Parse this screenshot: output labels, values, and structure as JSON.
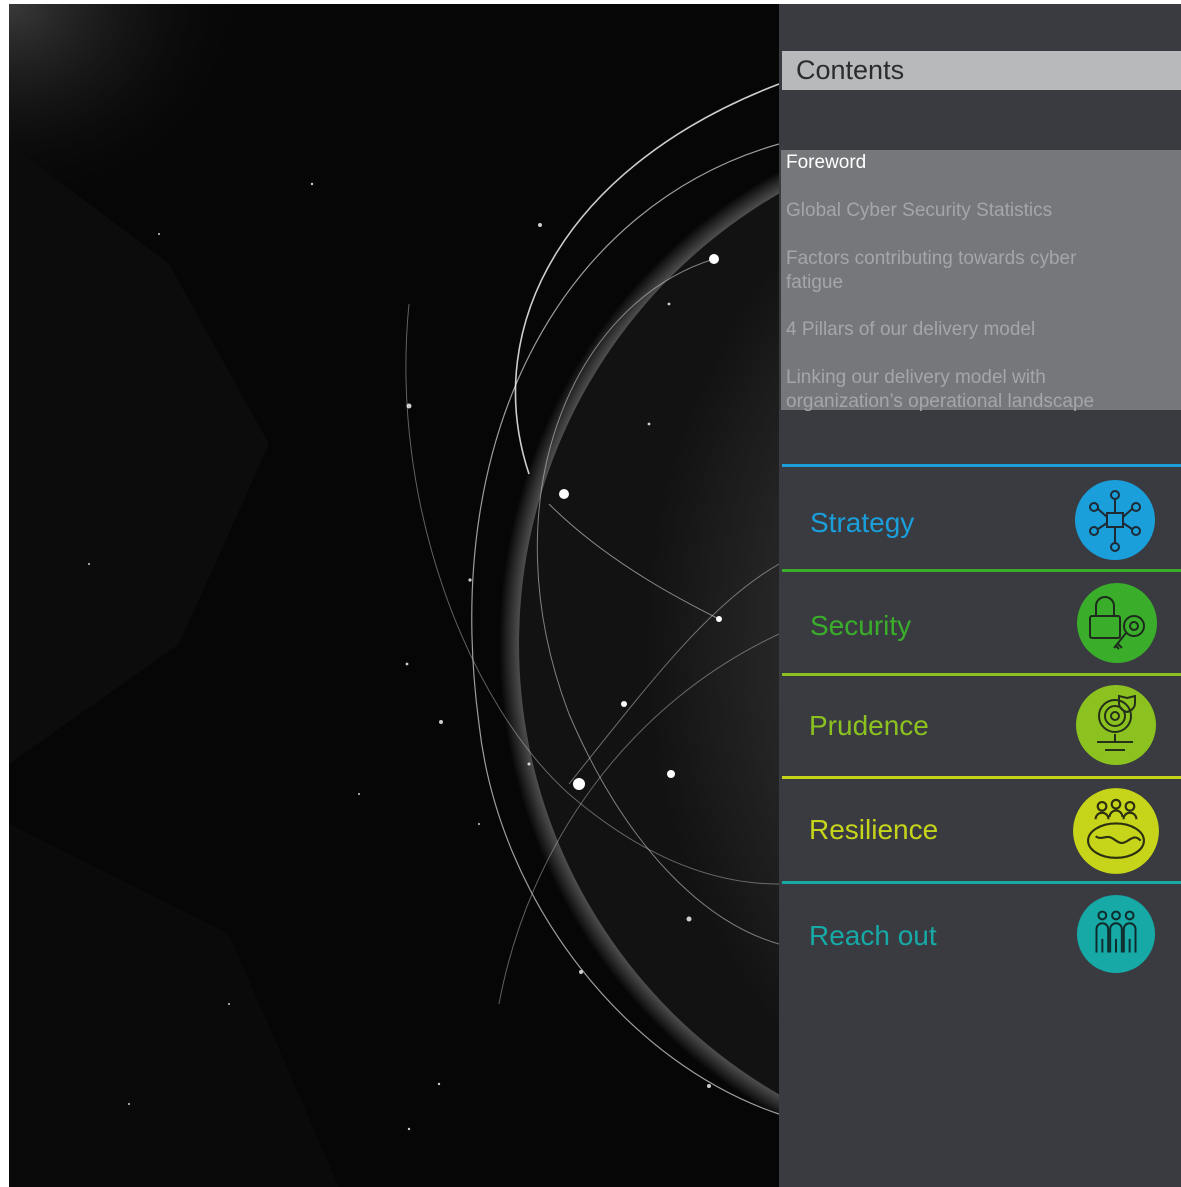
{
  "contents": {
    "title": "Contents"
  },
  "toc": {
    "items": [
      {
        "label": "Foreword",
        "active": true
      },
      {
        "label": "Global Cyber Security Statistics",
        "active": false
      },
      {
        "label": "Factors contributing towards cyber fatigue",
        "active": false
      },
      {
        "label": "4 Pillars of our delivery model",
        "active": false
      },
      {
        "label": "Linking our delivery model with organization’s operational landscape",
        "active": false
      }
    ]
  },
  "pillars": [
    {
      "label": "Strategy",
      "color": "#1a9fdb",
      "icon": "strategy-network-icon"
    },
    {
      "label": "Security",
      "color": "#3aae2a",
      "icon": "security-lock-key-icon"
    },
    {
      "label": "Prudence",
      "color": "#8cc21f",
      "icon": "prudence-target-icon"
    },
    {
      "label": "Resilience",
      "color": "#c6d51a",
      "icon": "resilience-team-globe-icon"
    },
    {
      "label": "Reach out",
      "color": "#16a9a6",
      "icon": "reach-out-people-icon"
    }
  ]
}
